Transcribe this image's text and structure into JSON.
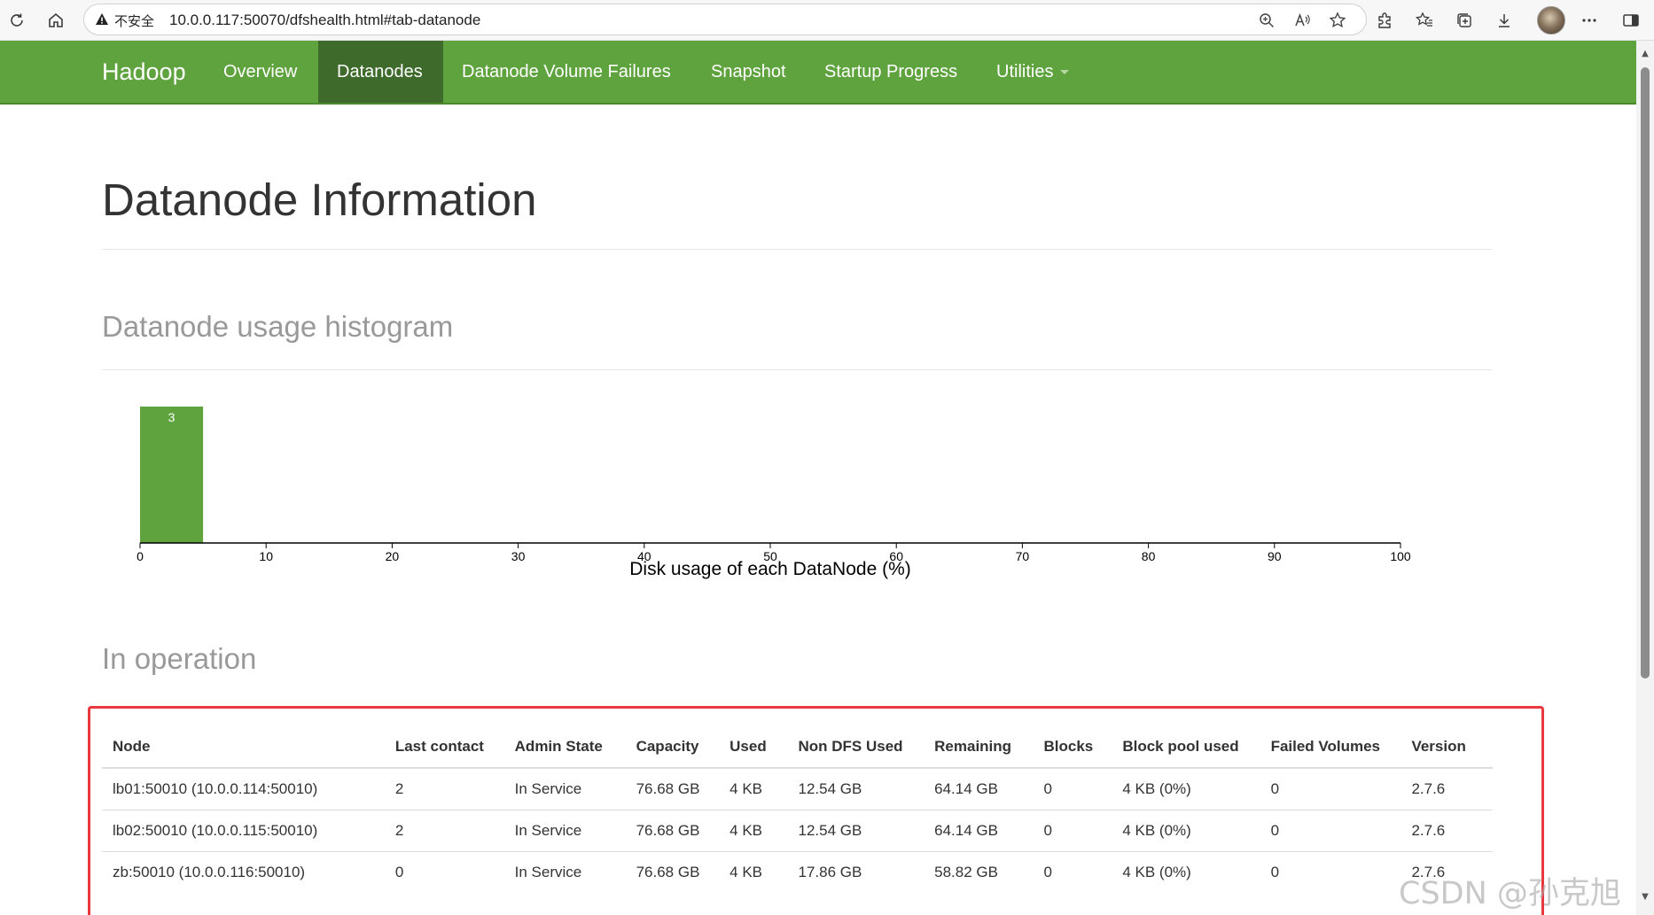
{
  "browser": {
    "security_label": "不安全",
    "url": "10.0.0.117:50070/dfshealth.html#tab-datanode"
  },
  "navbar": {
    "brand": "Hadoop",
    "items": [
      {
        "label": "Overview"
      },
      {
        "label": "Datanodes",
        "active": true
      },
      {
        "label": "Datanode Volume Failures"
      },
      {
        "label": "Snapshot"
      },
      {
        "label": "Startup Progress"
      },
      {
        "label": "Utilities"
      }
    ]
  },
  "page": {
    "title": "Datanode Information",
    "histogram_heading": "Datanode usage histogram",
    "operation_heading": "In operation"
  },
  "chart_data": {
    "type": "bar",
    "xlabel": "Disk usage of each DataNode (%)",
    "xlim": [
      0,
      100
    ],
    "x_ticks": [
      "0",
      "10",
      "20",
      "30",
      "40",
      "50",
      "60",
      "70",
      "80",
      "90",
      "100"
    ],
    "bins": [
      {
        "x0": 0,
        "x1": 5,
        "count": 3,
        "label": "3"
      }
    ],
    "bar_color": "#5fa33e",
    "grid": false
  },
  "table": {
    "columns": [
      "Node",
      "Last contact",
      "Admin State",
      "Capacity",
      "Used",
      "Non DFS Used",
      "Remaining",
      "Blocks",
      "Block pool used",
      "Failed Volumes",
      "Version"
    ],
    "rows": [
      [
        "lb01:50010 (10.0.0.114:50010)",
        "2",
        "In Service",
        "76.68 GB",
        "4 KB",
        "12.54 GB",
        "64.14 GB",
        "0",
        "4 KB (0%)",
        "0",
        "2.7.6"
      ],
      [
        "lb02:50010 (10.0.0.115:50010)",
        "2",
        "In Service",
        "76.68 GB",
        "4 KB",
        "12.54 GB",
        "64.14 GB",
        "0",
        "4 KB (0%)",
        "0",
        "2.7.6"
      ],
      [
        "zb:50010 (10.0.0.116:50010)",
        "0",
        "In Service",
        "76.68 GB",
        "4 KB",
        "17.86 GB",
        "58.82 GB",
        "0",
        "4 KB (0%)",
        "0",
        "2.7.6"
      ]
    ]
  },
  "watermark": "CSDN @孙克旭",
  "colors": {
    "navbar": "#5fa33e",
    "navbar_active": "#3e6b2c",
    "highlight": "#e8383d"
  }
}
